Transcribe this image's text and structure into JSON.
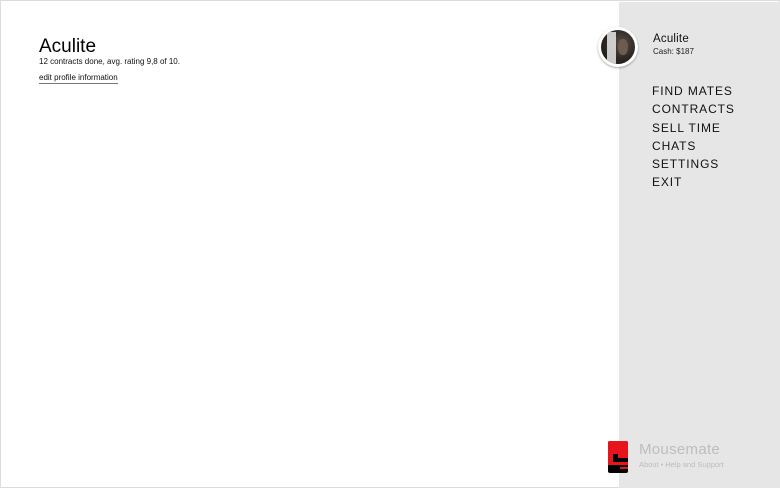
{
  "profile": {
    "name": "Aculite",
    "stats": "12 contracts done, avg. rating 9,8 of 10.",
    "edit_link": "edit profile information"
  },
  "user": {
    "name": "Aculite",
    "cash": "Cash: $187"
  },
  "nav": {
    "items": [
      {
        "label": "FIND MATES"
      },
      {
        "label": "CONTRACTS"
      },
      {
        "label": "SELL TIME"
      },
      {
        "label": "CHATS"
      },
      {
        "label": "SETTINGS"
      },
      {
        "label": "EXIT"
      }
    ]
  },
  "brand": {
    "name": "Mousemate",
    "about": "About",
    "separator": "•",
    "help": "Help and Support"
  },
  "colors": {
    "sidebar_bg": "#e6e6e6",
    "logo_red": "#e8141b",
    "logo_black": "#000000",
    "muted_text": "#bdbdbd"
  }
}
